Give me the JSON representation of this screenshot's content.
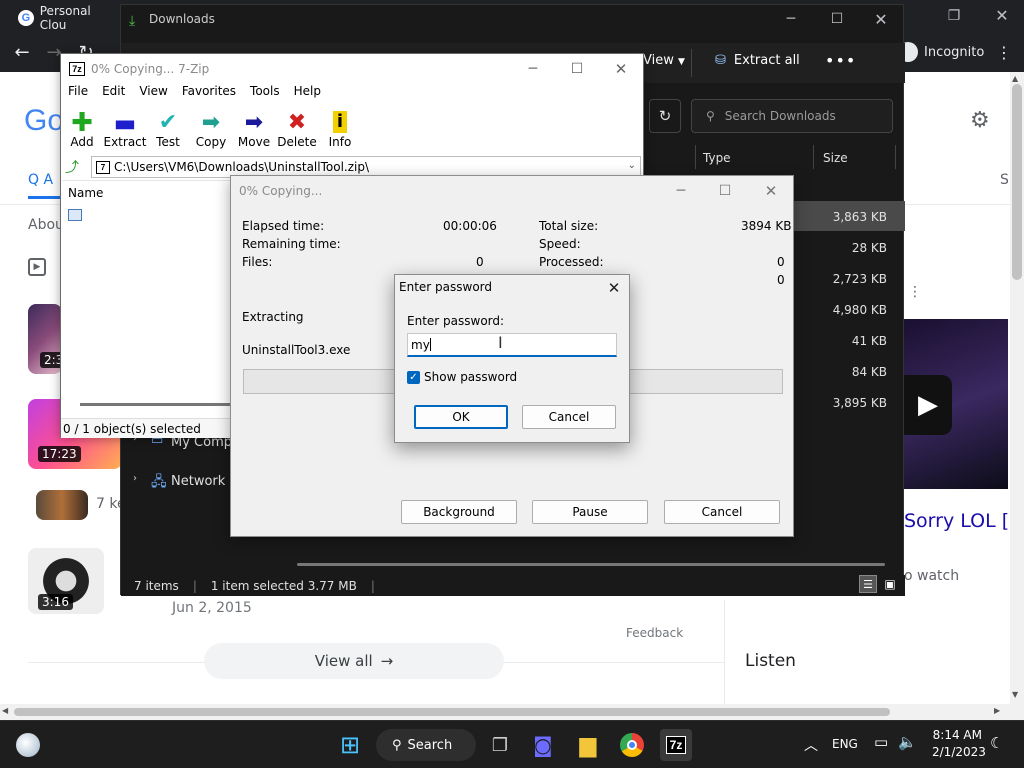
{
  "chrome": {
    "tab_title": "Personal Clou",
    "incognito_label": "Incognito",
    "google_logo": "Go",
    "google_tab_partial": "A",
    "about_partial": "Abou",
    "result_s_partial": "S",
    "videos": [
      {
        "duration": "2:3"
      },
      {
        "duration": "17:23"
      },
      {
        "duration": ""
      },
      {
        "duration": "3:16"
      }
    ],
    "video_meta_partial": "7 ke",
    "video_date": "Jun 2, 2015",
    "feedback": "Feedback",
    "view_all": "View all",
    "sorry_lol_partial": "Sorry LOL [",
    "watch_partial": "o watch",
    "listen": "Listen"
  },
  "explorer": {
    "title": "Downloads",
    "toolbar_view": "View",
    "extract_all": "Extract all",
    "search_placeholder": "Search Downloads",
    "columns": {
      "type": "Type",
      "size": "Size"
    },
    "sizes": [
      "3,863 KB",
      "28 KB",
      "2,723 KB",
      "4,980 KB",
      "41 KB",
      "84 KB",
      "3,895 KB"
    ],
    "nav_items": [
      {
        "label": "My Compu"
      },
      {
        "label": "Network"
      }
    ],
    "status_items": "7 items",
    "status_selected": "1 item selected  3.77 MB"
  },
  "zip": {
    "title": "0% Copying... 7-Zip",
    "menu": [
      "File",
      "Edit",
      "View",
      "Favorites",
      "Tools",
      "Help"
    ],
    "tools": [
      {
        "label": "Add",
        "glyph": "+",
        "color": "#1fa81f"
      },
      {
        "label": "Extract",
        "glyph": "━",
        "color": "#1e1ecc"
      },
      {
        "label": "Test",
        "glyph": "✔",
        "color": "#22b3b3"
      },
      {
        "label": "Copy",
        "glyph": "➡",
        "color": "#1f9f8f"
      },
      {
        "label": "Move",
        "glyph": "➡",
        "color": "#1a1a9a"
      },
      {
        "label": "Delete",
        "glyph": "✖",
        "color": "#d02020"
      },
      {
        "label": "Info",
        "glyph": "i",
        "color": "#c9a800"
      }
    ],
    "path": "C:\\Users\\VM6\\Downloads\\UninstallTool.zip\\",
    "col_name": "Name",
    "status": "0 / 1 object(s) selected"
  },
  "copying": {
    "title": "0% Copying...",
    "elapsed_label": "Elapsed time:",
    "elapsed_value": "00:00:06",
    "remaining_label": "Remaining time:",
    "files_label": "Files:",
    "files_value": "0",
    "total_size_label": "Total size:",
    "total_size_value": "3894 KB",
    "speed_label": "Speed:",
    "processed_label": "Processed:",
    "processed_value": "0",
    "extra_value": "0",
    "action": "Extracting",
    "file": "UninstallTool3.exe",
    "btn_background": "Background",
    "btn_pause": "Pause",
    "btn_cancel": "Cancel"
  },
  "password": {
    "title": "Enter password",
    "label": "Enter password:",
    "value": "my",
    "show_password": "Show password",
    "show_password_checked": true,
    "ok": "OK",
    "cancel": "Cancel"
  },
  "taskbar": {
    "search": "Search",
    "lang": "ENG",
    "time": "8:14 AM",
    "date": "2/1/2023"
  }
}
